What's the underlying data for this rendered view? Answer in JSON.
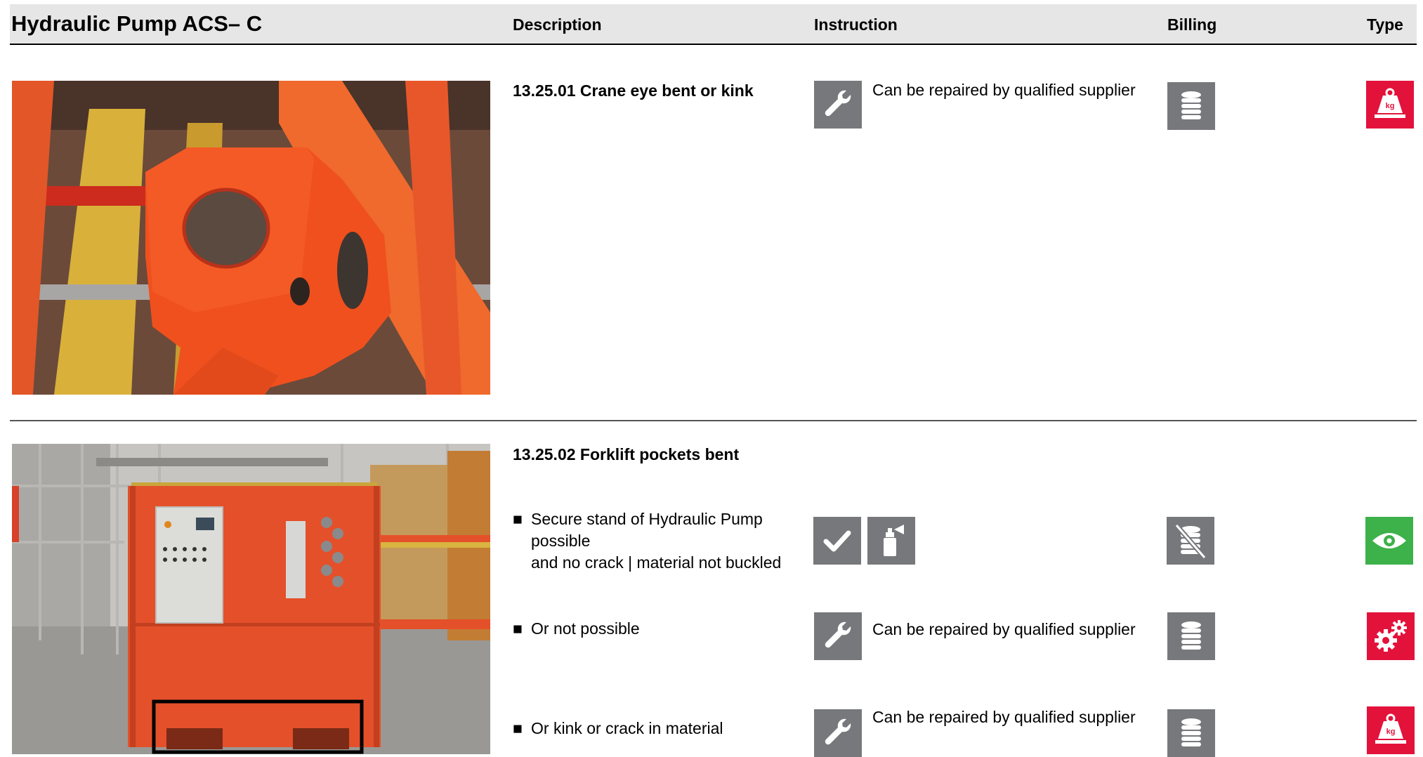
{
  "header": {
    "title": "Hydraulic Pump ACS– C",
    "columns": {
      "description": "Description",
      "instruction": "Instruction",
      "billing": "Billing",
      "type": "Type"
    }
  },
  "sections": [
    {
      "title": "13.25.01 Crane eye bent or kink",
      "instruction_text": "Can be repaired by qualified supplier",
      "instruction_icon": "wrench-icon",
      "billing_icon": "coin-stack-icon",
      "type_icon": "weight-kg-icon"
    },
    {
      "title": "13.25.02 Forklift pockets bent",
      "rows": [
        {
          "bullet": "■",
          "lines": [
            "Secure stand of Hydraulic Pump",
            "possible",
            "and no crack | material not buckled"
          ],
          "instruction_icons": [
            "checkmark-icon",
            "spray-can-icon"
          ],
          "billing_icon": "no-charge-icon",
          "type_icon": "eye-icon"
        },
        {
          "bullet": "■",
          "lines": [
            "Or not possible"
          ],
          "instruction_text": "Can be repaired by qualified supplier",
          "instruction_icon": "wrench-icon",
          "billing_icon": "coin-stack-icon",
          "type_icon": "gears-icon"
        },
        {
          "bullet": "■",
          "lines": [
            "Or kink or crack in material"
          ],
          "instruction_text": "Can be repaired by qualified supplier",
          "instruction_icon": "wrench-icon",
          "billing_icon": "coin-stack-icon",
          "type_icon": "weight-kg-icon"
        }
      ]
    }
  ],
  "colors": {
    "header_bg": "#e6e6e6",
    "icon_gray": "#77787b",
    "icon_red": "#e3123b",
    "icon_green": "#3db14a",
    "pump_orange": "#e4502a"
  }
}
